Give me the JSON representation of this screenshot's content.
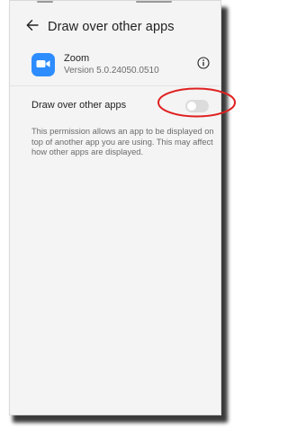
{
  "header": {
    "back_icon": "back-arrow-icon",
    "title": "Draw over other apps"
  },
  "app": {
    "icon": "zoom-video-icon",
    "brand_color": "#2d8cff",
    "name": "Zoom",
    "version": "Version 5.0.24050.0510",
    "info_icon": "info-icon"
  },
  "setting": {
    "label": "Draw over other apps",
    "enabled": false
  },
  "description": "This permission allows an app to be displayed on top of another app you are using. This may affect how other apps are displayed.",
  "annotation": {
    "shape": "ellipse",
    "color": "#e02020",
    "target": "toggle"
  }
}
